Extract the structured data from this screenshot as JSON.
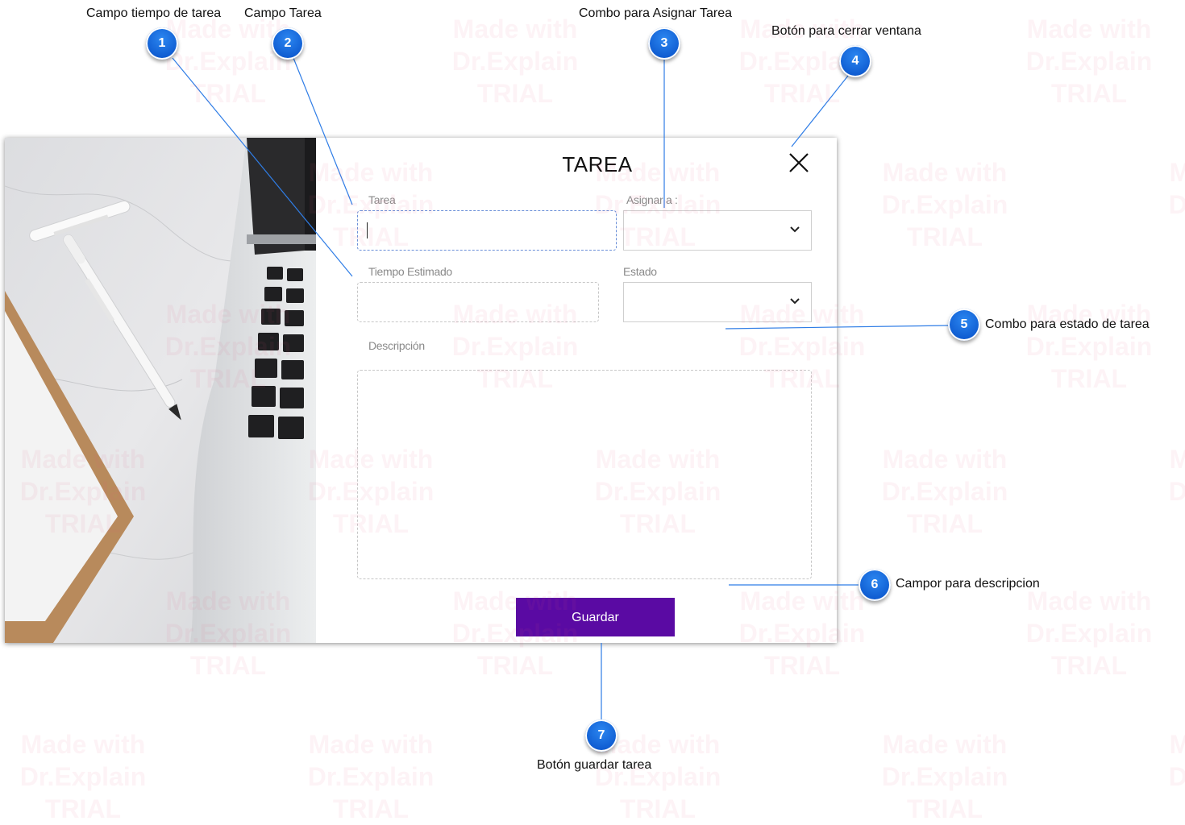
{
  "dialog": {
    "title": "TAREA",
    "fields": {
      "tarea": {
        "label": "Tarea",
        "value": ""
      },
      "asignar": {
        "label": "Asignar a :",
        "value": ""
      },
      "tiempo": {
        "label": "Tiempo Estimado",
        "value": ""
      },
      "estado": {
        "label": "Estado",
        "value": ""
      },
      "descripcion": {
        "label": "Descripción",
        "value": ""
      }
    },
    "save_button": "Guardar",
    "close_icon": "close-icon",
    "accent_color": "#5a0aa3"
  },
  "callouts": [
    {
      "number": "1",
      "label": "Campo tiempo de tarea"
    },
    {
      "number": "2",
      "label": "Campo Tarea"
    },
    {
      "number": "3",
      "label": "Combo para Asignar Tarea"
    },
    {
      "number": "4",
      "label": "Botón para cerrar ventana"
    },
    {
      "number": "5",
      "label": "Combo para estado de tarea"
    },
    {
      "number": "6",
      "label": "Campor para descripcion"
    },
    {
      "number": "7",
      "label": "Botón guardar tarea"
    }
  ],
  "watermark": {
    "line1": "Made with",
    "line2": "Dr.Explain",
    "line3": "TRIAL"
  },
  "callout_color": "#1a6fe0"
}
